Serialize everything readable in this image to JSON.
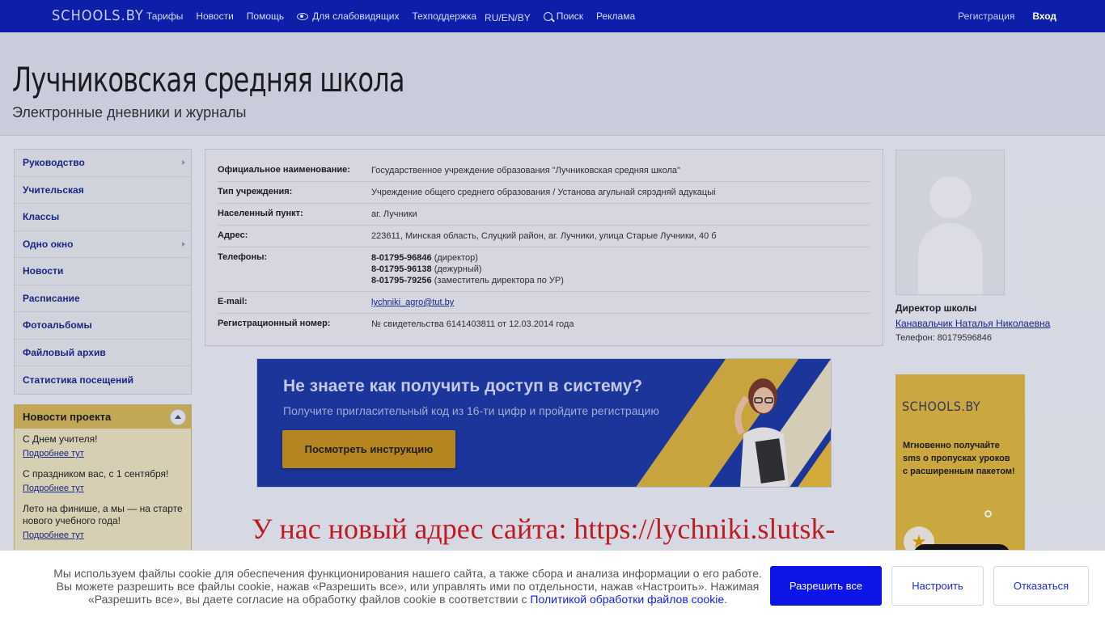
{
  "topbar": {
    "logo": "SCHOOLS.BY",
    "nav": {
      "tariffs": "Тарифы",
      "news": "Новости",
      "help": "Помощь",
      "accessibility": "Для слабовидящих",
      "support": "Техподдержка",
      "languages": "RU/EN/BY",
      "search": "Поиск",
      "ads": "Реклама"
    },
    "register": "Регистрация",
    "login": "Вход"
  },
  "header": {
    "title": "Лучниковская средняя школа",
    "subtitle": "Электронные дневники и журналы"
  },
  "sidebar": {
    "items": [
      {
        "label": "Руководство",
        "has_arrow": true
      },
      {
        "label": "Учительская",
        "has_arrow": false
      },
      {
        "label": "Классы",
        "has_arrow": false
      },
      {
        "label": "Одно окно",
        "has_arrow": true
      },
      {
        "label": "Новости",
        "has_arrow": false
      },
      {
        "label": "Расписание",
        "has_arrow": false
      },
      {
        "label": "Фотоальбомы",
        "has_arrow": false
      },
      {
        "label": "Файловый архив",
        "has_arrow": false
      },
      {
        "label": "Статистика посещений",
        "has_arrow": false
      }
    ]
  },
  "news": {
    "title": "Новости проекта",
    "items": [
      {
        "text": "С Днем учителя!",
        "more": "Подробнее тут"
      },
      {
        "text": "С праздником вас, с 1 сентября!",
        "more": "Подробнее тут"
      },
      {
        "text": "Лето на финише, а мы — на старте нового учебного года!",
        "more": "Подробнее тут"
      }
    ]
  },
  "info": {
    "official_name_label": "Официальное наименование:",
    "official_name": "Государственное учреждение образования \"Лучниковская средняя школа\"",
    "type_label": "Тип учреждения:",
    "type": "Учреждение общего среднего образования / Установа агульнай сярэдняй адукацыі",
    "locality_label": "Населенный пункт:",
    "locality": "аг. Лучники",
    "address_label": "Адрес:",
    "address": "223611, Минская область, Слуцкий район, аг. Лучники, улица Старые Лучники, 40 б",
    "phones_label": "Телефоны:",
    "phones": [
      {
        "number": "8-01795-96846",
        "note": "(директор)"
      },
      {
        "number": "8-01795-96138",
        "note": "(дежурный)"
      },
      {
        "number": "8-01795-79256",
        "note": "(заместитель директора по УР)"
      }
    ],
    "email_label": "E-mail:",
    "email": "lychniki_agro@tut.by",
    "regnum_label": "Регистрационный номер:",
    "regnum": "№ свидетельства 6141403811 от 12.03.2014 года"
  },
  "banner": {
    "heading": "Не знаете как получить доступ в систему?",
    "sub": "Получите пригласительный код из 16-ти цифр и пройдите регистрацию",
    "button": "Посмотреть инструкцию"
  },
  "new_address": "У нас новый адрес сайта: https://lychniki.slutsk-",
  "director": {
    "title": "Директор школы",
    "name": "Канавальчик Наталья Николаевна",
    "phone": "Телефон: 80179596846"
  },
  "ad": {
    "logo": "SCHOOLS.BY",
    "text": "Мгновенно получайте sms о пропусках уроков с расширенным пакетом!"
  },
  "cookie": {
    "text": "Мы используем файлы cookie для обеспечения функционирования нашего сайта, а также сбора и анализа информации о его работе. Вы можете разрешить все файлы cookie, нажав «Разрешить все», или управлять ими по отдельности, нажав «Настроить». Нажимая «Разрешить все», вы даете согласие на обработку файлов cookie в соответствии с",
    "link": "Политикой обработки файлов cookie",
    "tail": ".",
    "allow_all": "Разрешить все",
    "configure": "Настроить",
    "decline": "Отказаться"
  },
  "colors": {
    "topbar": "#0d1fa8",
    "link": "#1a2a8c",
    "accent_red": "#d21d1d",
    "allow_button": "#0c14e6"
  }
}
